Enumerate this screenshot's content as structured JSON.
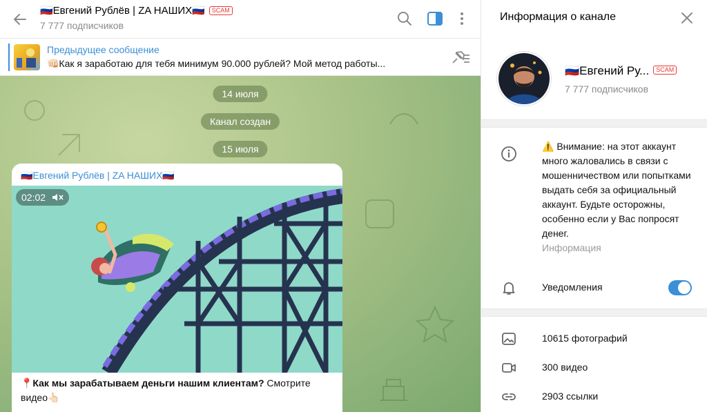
{
  "chat": {
    "header": {
      "title": "🇷🇺Евгений Рублёв | ZA НАШИХ🇷🇺",
      "scam_badge": "SCAM",
      "subscribers": "7 777 подписчиков",
      "icons": [
        "back-arrow-icon",
        "search-icon",
        "sidebar-toggle-icon",
        "more-vertical-icon"
      ]
    },
    "pinned": {
      "title": "Предыдущее сообщение",
      "text": "👊🏻Как я заработаю для тебя минимум 90.000 рублей? Мой метод работы..."
    },
    "service": {
      "date1": "14 июля",
      "created": "Канал создан",
      "date2": "15 июля"
    },
    "message": {
      "author": "🇷🇺Евгений Рублёв | ZA НАШИХ🇷🇺",
      "timer": "02:02",
      "text_bold": "📍Как мы зарабатываем деньги нашим клиентам?",
      "text_rest": " Смотрите видео👆🏻"
    }
  },
  "info_panel": {
    "title": "Информация о канале",
    "channel_name": "🇷🇺Евгений Ру...",
    "scam_badge": "SCAM",
    "subscribers": "7 777 подписчиков",
    "warning_text": "⚠️ Внимание: на этот аккаунт много жаловались в связи с мошенничеством или попытками выдать себя за официальный аккаунт. Будьте осторожны, особенно если у Вас попросят денег.",
    "warning_label": "Информация",
    "notifications_label": "Уведомления",
    "notifications_on": true,
    "stats": {
      "photos": "10615 фотографий",
      "videos": "300 видео",
      "links": "2903 ссылки"
    }
  },
  "colors": {
    "accent": "#3a8fd6",
    "scam": "#e53935",
    "wallpaper": "#a8c286"
  }
}
